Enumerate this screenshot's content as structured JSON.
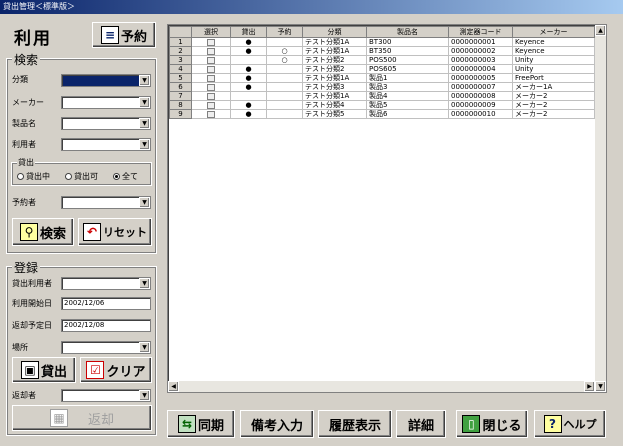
{
  "window": {
    "title": "貸出管理＜標準版＞"
  },
  "mode": {
    "title": "利用",
    "reserve_button": "予約"
  },
  "search": {
    "title": "検索",
    "category_label": "分類",
    "maker_label": "メーカー",
    "product_label": "製品名",
    "user_label": "利用者",
    "loan_group": "貸出",
    "radio_lent": "貸出中",
    "radio_available": "貸出可",
    "radio_all": "全て",
    "reserver_label": "予約者",
    "search_button": "検索",
    "reset_button": "リセット"
  },
  "register": {
    "title": "登録",
    "loan_user_label": "貸出利用者",
    "start_date_label": "利用開始日",
    "start_date_value": "2002/12/06",
    "return_date_label": "返却予定日",
    "return_date_value": "2002/12/08",
    "location_label": "場所",
    "lend_button": "貸出",
    "clear_button": "クリア",
    "returner_label": "返却者",
    "return_button": "返却"
  },
  "table": {
    "headers": [
      "選択",
      "貸出",
      "予約",
      "分類",
      "製品名",
      "測定器コード",
      "メーカー"
    ],
    "rows": [
      {
        "num": "1",
        "lent": "●",
        "reserved": "",
        "category": "テスト分類1A",
        "product": "BT300",
        "code": "0000000001",
        "maker": "Keyence"
      },
      {
        "num": "2",
        "lent": "●",
        "reserved": "○",
        "category": "テスト分類1A",
        "product": "BT350",
        "code": "0000000002",
        "maker": "Keyence"
      },
      {
        "num": "3",
        "lent": "",
        "reserved": "○",
        "category": "テスト分類2",
        "product": "POS500",
        "code": "0000000003",
        "maker": "Unity"
      },
      {
        "num": "4",
        "lent": "●",
        "reserved": "",
        "category": "テスト分類2",
        "product": "POS605",
        "code": "0000000004",
        "maker": "Unity"
      },
      {
        "num": "5",
        "lent": "●",
        "reserved": "",
        "category": "テスト分類1A",
        "product": "製品1",
        "code": "0000000005",
        "maker": "FreePort"
      },
      {
        "num": "6",
        "lent": "●",
        "reserved": "",
        "category": "テスト分類3",
        "product": "製品3",
        "code": "0000000007",
        "maker": "メーカー1A"
      },
      {
        "num": "7",
        "lent": "",
        "reserved": "",
        "category": "テスト分類1A",
        "product": "製品4",
        "code": "0000000008",
        "maker": "メーカー2"
      },
      {
        "num": "8",
        "lent": "●",
        "reserved": "",
        "category": "テスト分類4",
        "product": "製品5",
        "code": "0000000009",
        "maker": "メーカー2"
      },
      {
        "num": "9",
        "lent": "●",
        "reserved": "",
        "category": "テスト分類5",
        "product": "製品6",
        "code": "0000000010",
        "maker": "メーカー2"
      }
    ]
  },
  "bottom": {
    "sync_button": "同期",
    "note_button": "備考入力",
    "history_button": "履歴表示",
    "detail_button": "詳細",
    "close_button": "閉じる",
    "help_button": "ヘルプ"
  },
  "colors": {
    "titlebar": "#0a246a",
    "accent_red": "#cc0000",
    "face": "#d4d0c8"
  }
}
